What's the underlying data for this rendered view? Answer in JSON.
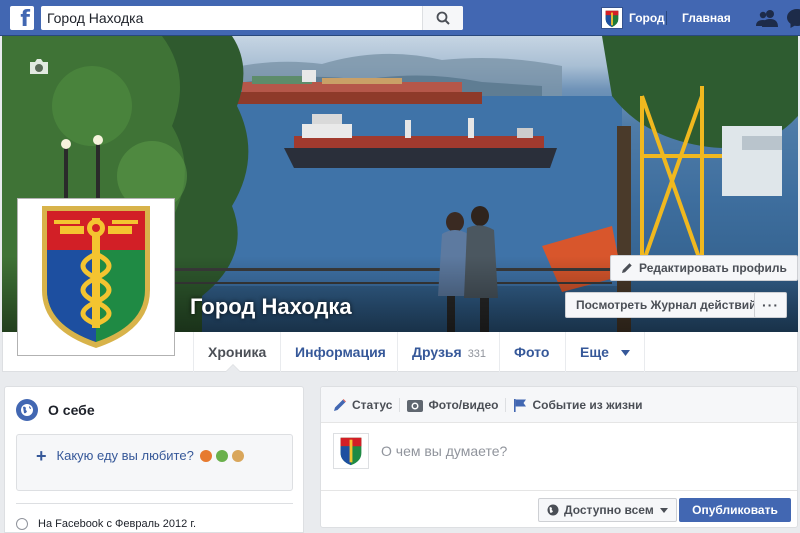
{
  "topbar": {
    "logo": "f",
    "search_value": "Город Находка",
    "profile_name": "Город",
    "home_label": "Главная",
    "icons": [
      "search-icon",
      "friends-icon",
      "messages-icon"
    ]
  },
  "cover": {
    "page_name": "Город Находка",
    "edit_profile_label": "Редактировать профиль",
    "activity_log_label": "Посмотреть Журнал действий",
    "more_label": "···"
  },
  "nav": {
    "tabs": [
      {
        "label": "Хроника",
        "active": true
      },
      {
        "label": "Информация"
      },
      {
        "label": "Друзья",
        "count": "331"
      },
      {
        "label": "Фото"
      },
      {
        "label": "Еще"
      }
    ]
  },
  "about": {
    "title": "О себе",
    "food_prompt": "Какую еду вы любите?",
    "joined": "На Facebook с Февраль 2012 г."
  },
  "composer": {
    "tabs": [
      {
        "label": "Статус",
        "icon": "pencil-icon"
      },
      {
        "label": "Фото/видео",
        "icon": "camera-icon"
      },
      {
        "label": "Событие из жизни",
        "icon": "flag-icon"
      }
    ],
    "placeholder": "О чем вы думаете?",
    "privacy_label": "Доступно всем",
    "publish_label": "Опубликовать"
  },
  "colors": {
    "brand": "#4267b2",
    "link": "#365899",
    "background": "#e9ebee"
  }
}
